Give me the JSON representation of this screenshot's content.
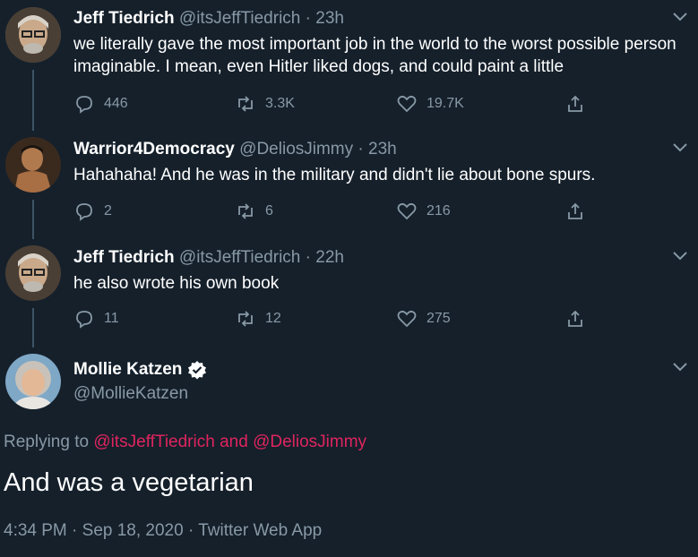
{
  "tweets": [
    {
      "name": "Jeff Tiedrich",
      "handle": "@itsJeffTiedrich",
      "time": "23h",
      "text": "we literally gave the most important job in the world to the worst possible person imaginable. I mean, even Hitler liked dogs, and could paint a little",
      "replies": "446",
      "retweets": "3.3K",
      "likes": "19.7K"
    },
    {
      "name": "Warrior4Democracy",
      "handle": "@DeliosJimmy",
      "time": "23h",
      "text": "Hahahaha! And he was in the military and didn't lie about bone spurs.",
      "replies": "2",
      "retweets": "6",
      "likes": "216"
    },
    {
      "name": "Jeff Tiedrich",
      "handle": "@itsJeffTiedrich",
      "time": "22h",
      "text": "he also wrote his own book",
      "replies": "11",
      "retweets": "12",
      "likes": "275"
    }
  ],
  "main": {
    "name": "Mollie Katzen",
    "handle": "@MollieKatzen",
    "replying_prefix": "Replying to",
    "mention1": "@itsJeffTiedrich",
    "and": "and",
    "mention2": "@DeliosJimmy",
    "text": "And was a vegetarian",
    "meta": "4:34 PM · Sep 18, 2020 · Twitter Web App"
  },
  "separator": "·",
  "colors": {
    "background": "#15202b",
    "secondary_text": "#8899a6",
    "mention": "#e0245e",
    "thread_line": "#3d5466"
  }
}
